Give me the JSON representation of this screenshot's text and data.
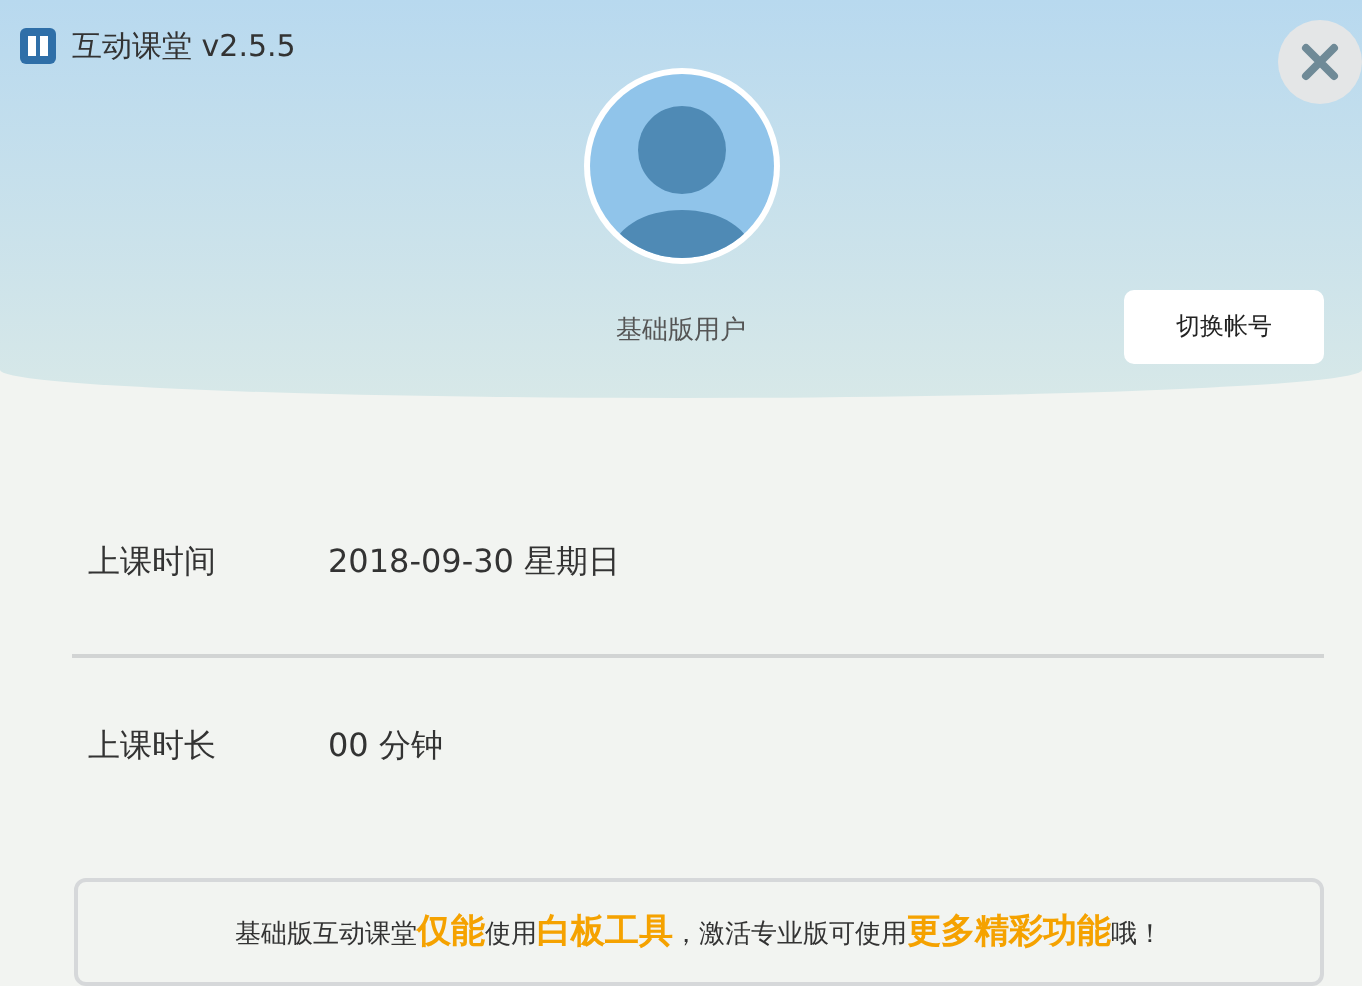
{
  "window": {
    "title": "互动课堂 v2.5.5"
  },
  "account": {
    "user_type": "基础版用户",
    "switch_button": "切换帐号"
  },
  "info_rows": [
    {
      "label": "上课时间",
      "value": "2018-09-30 星期日"
    },
    {
      "label": "上课时长",
      "value": "00 分钟"
    }
  ],
  "notice": "基础版互动课堂**仅能**使用**白板工具**，激活专业版可使用**更多精彩功能**哦！"
}
